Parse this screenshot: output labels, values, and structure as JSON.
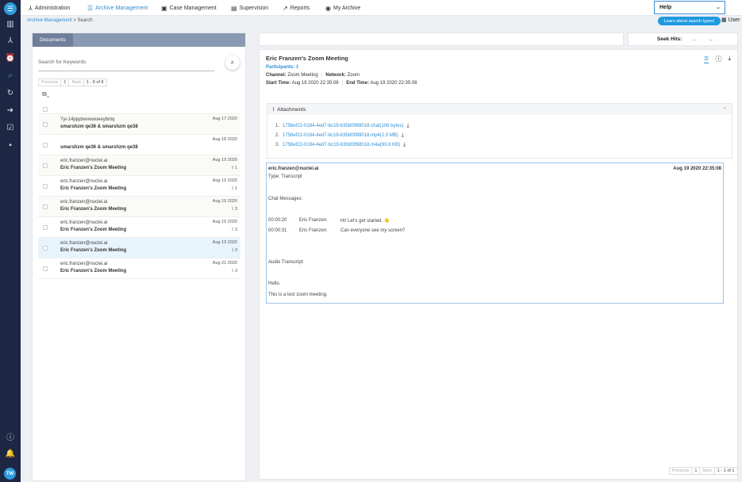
{
  "rail": {
    "avatar": "TW"
  },
  "topnav": {
    "tabs": [
      {
        "label": "Administration"
      },
      {
        "label": "Archive Management"
      },
      {
        "label": "Case Management"
      },
      {
        "label": "Supervision"
      },
      {
        "label": "Reports"
      },
      {
        "label": "My Archive"
      }
    ],
    "help_label": "Help",
    "help_tip": "Learn about search types!",
    "user_label": "User"
  },
  "breadcrumb": {
    "root": "Archive Management",
    "current": "Search"
  },
  "documents": {
    "tab_label": "Documents",
    "search_placeholder": "Search for Keywords",
    "pager": {
      "prev": "Previous",
      "page": "1",
      "next": "Next",
      "range": "1 - 8 of 8"
    },
    "rows": [
      {
        "from": "7yi-14jqqdwvwwoeeybntq",
        "subject": "smarshzm qe36 & smarshzm qe38",
        "date": "Aug 17 2020",
        "attachments": ""
      },
      {
        "from": "",
        "subject": "smarshzm qe36 & smarshzm qe38",
        "date": "Aug 18 2020",
        "attachments": ""
      },
      {
        "from": "eric.franzen@nuclei.ai",
        "subject": "Eric Franzen's Zoom Meeting",
        "date": "Aug 19 2020",
        "attachments": "1"
      },
      {
        "from": "eric.franzen@nuclei.ai",
        "subject": "Eric Franzen's Zoom Meeting",
        "date": "Aug 19 2020",
        "attachments": "1"
      },
      {
        "from": "eric.franzen@nuclei.ai",
        "subject": "Eric Franzen's Zoom Meeting",
        "date": "Aug 19 2020",
        "attachments": "3"
      },
      {
        "from": "eric.franzen@nuclei.ai",
        "subject": "Eric Franzen's Zoom Meeting",
        "date": "Aug 19 2020",
        "attachments": "3"
      },
      {
        "from": "eric.franzen@nuclei.ai",
        "subject": "Eric Franzen's Zoom Meeting",
        "date": "Aug 19 2020",
        "attachments": "3"
      },
      {
        "from": "eric.franzen@nuclei.ai",
        "subject": "Eric Franzen's Zoom Meeting",
        "date": "Aug 21 2020",
        "attachments": "3"
      }
    ]
  },
  "seek": {
    "label": "Seek Hits:"
  },
  "detail": {
    "title": "Eric Franzen's Zoom Meeting",
    "participants": "Participants: 1",
    "channel_label": "Channel:",
    "channel": "Zoom Meeting",
    "network_label": "Network:",
    "network": "Zoom",
    "start_label": "Start Time:",
    "start": "Aug 19 2020 22:35:08",
    "end_label": "End Time:",
    "end": "Aug 19 2020 22:35:08",
    "attachments_label": "Attachments",
    "attachments": [
      {
        "n": "1.",
        "name": "1756ef22-0184-4ed7-bc19-b35bf3f88018.chat(106 bytes)"
      },
      {
        "n": "2.",
        "name": "1756ef22-0184-4ed7-bc19-b35bf3f88018.mp4(2.3 MB)"
      },
      {
        "n": "3.",
        "name": "1756ef22-0184-4ed7-bc19-b35bf3f88018.m4a(93.6 KB)"
      }
    ],
    "message": {
      "sender": "eric.franzen@nuclei.ai",
      "date": "Aug 19 2020 22:35:08",
      "type": "Type: Transcript",
      "chat_heading": "Chat Messages:",
      "chat": [
        {
          "time": "00:00:20",
          "who": "Eric Franzen:",
          "text": "Hi! Let's get started. 👋"
        },
        {
          "time": "00:00:31",
          "who": "Eric Franzen:",
          "text": "Can everyone see my screen?"
        }
      ],
      "audio_heading": "Audio Transcript:",
      "audio": [
        "Hello.",
        "This is a test zoom meeting."
      ]
    },
    "pager": {
      "prev": "Previous",
      "page": "1",
      "next": "Next",
      "range": "1 - 1 of 1"
    }
  }
}
